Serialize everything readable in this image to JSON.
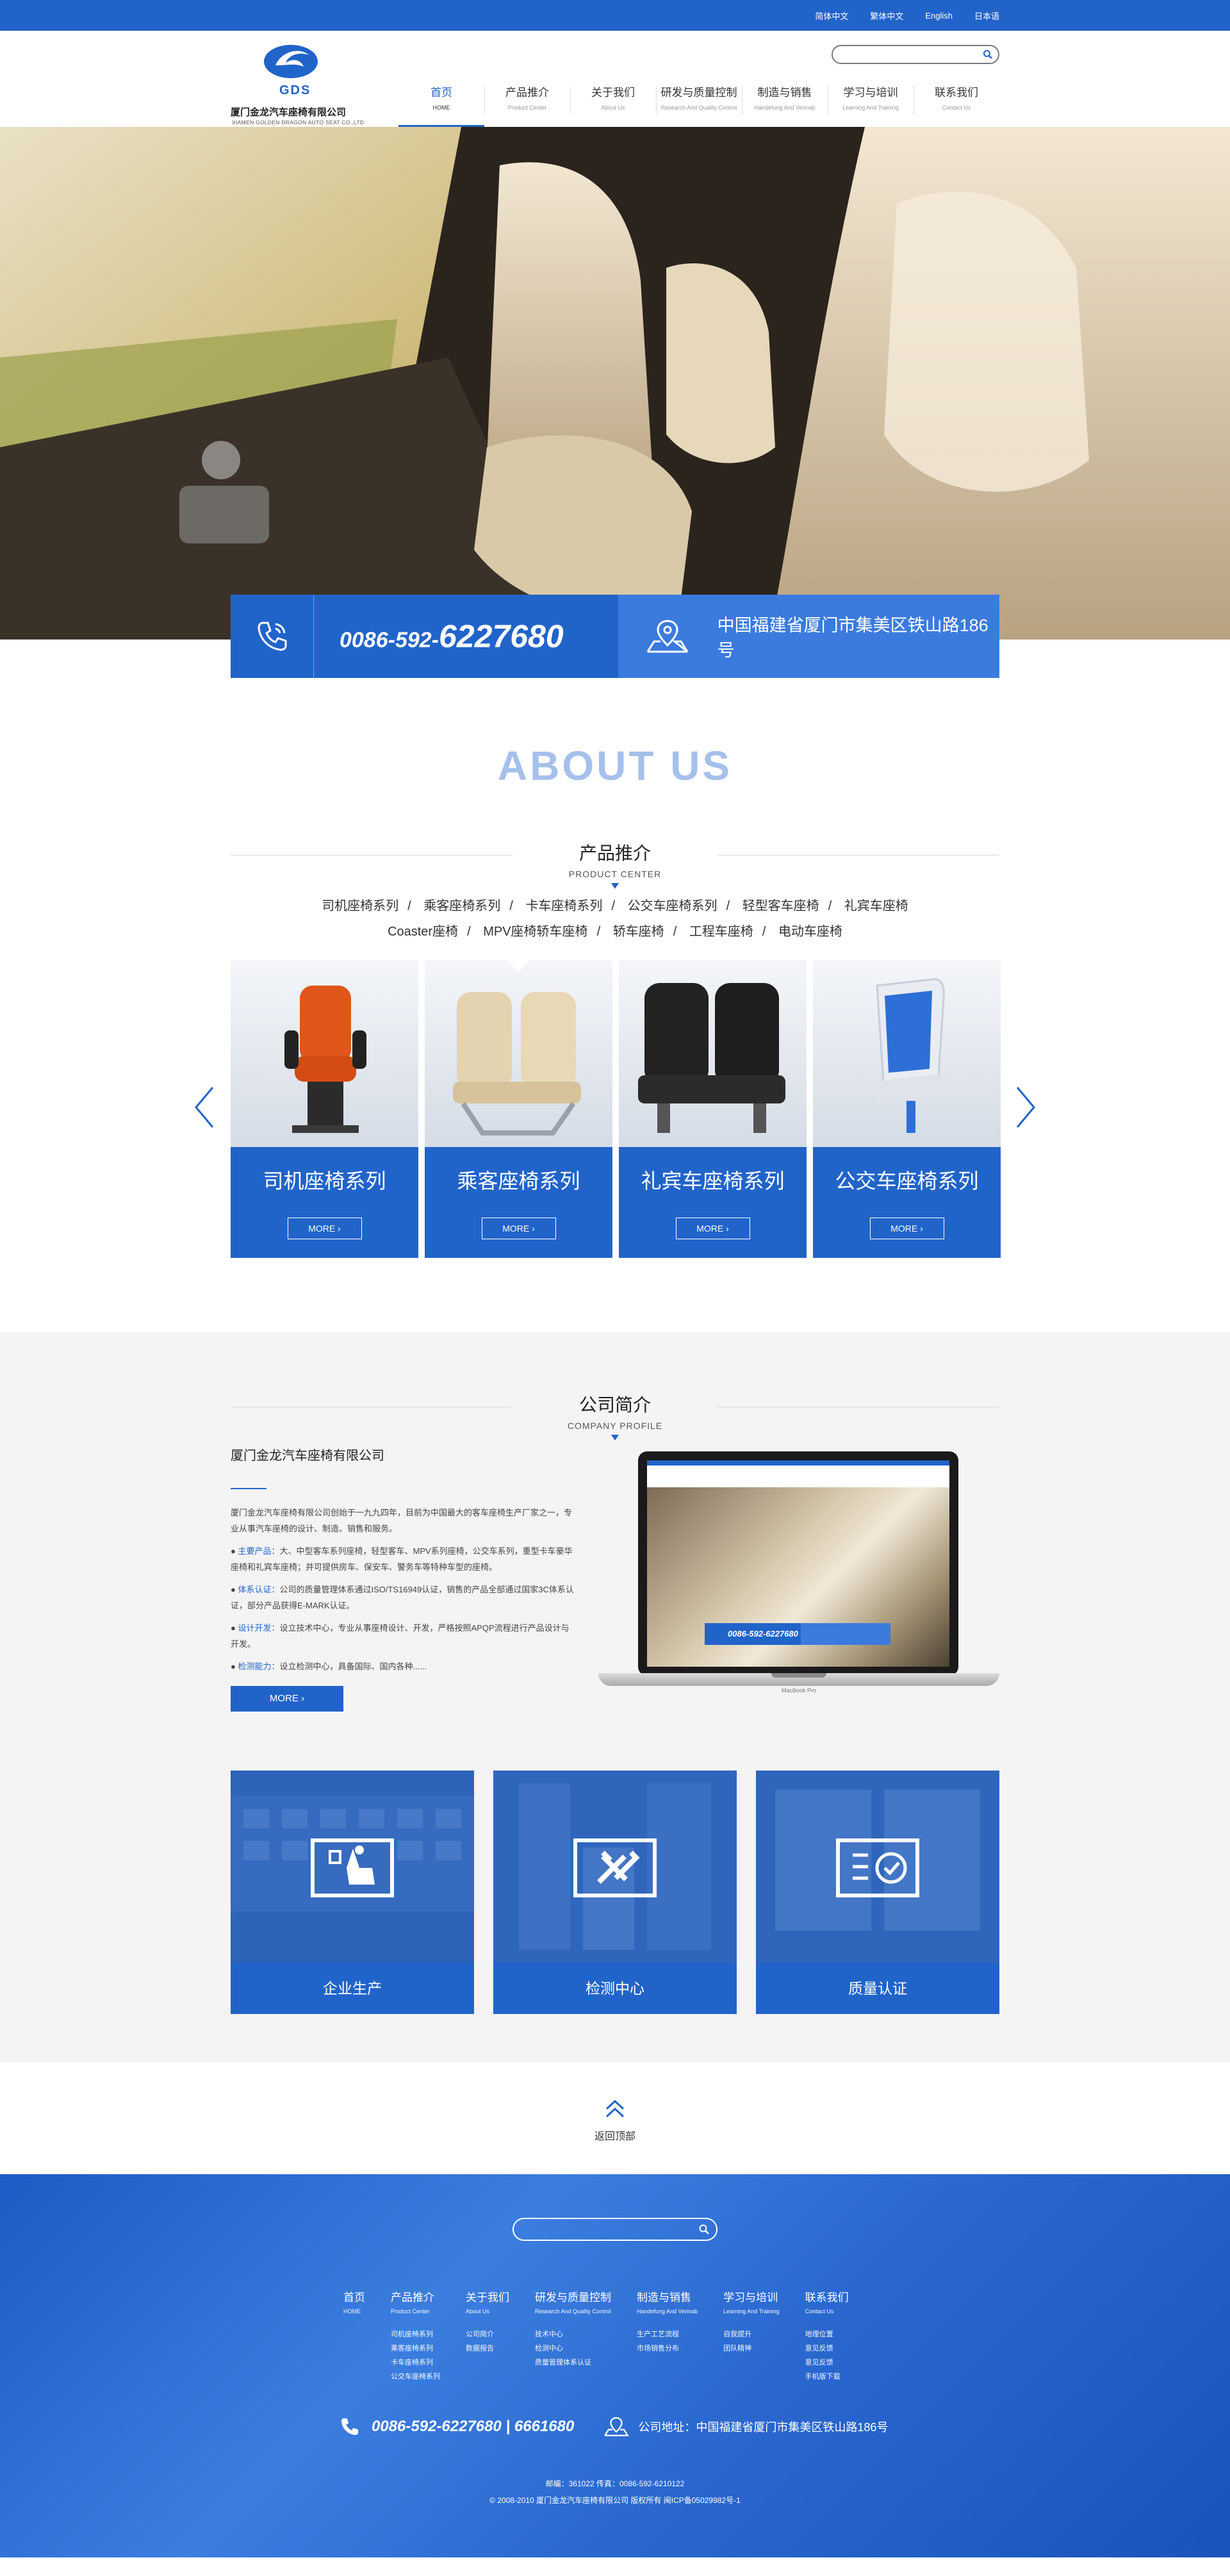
{
  "topbar": {
    "links": [
      "简体中文",
      "繁体中文",
      "English",
      "日本语"
    ]
  },
  "header": {
    "logo_abbr": "GDS",
    "company_cn": "厦门金龙汽车座椅有限公司",
    "company_en": "XIAMEN GOLDEN DRAGON AUTO SEAT CO.,LTD",
    "search_placeholder": ""
  },
  "nav": [
    {
      "cn": "首页",
      "en": "HOME",
      "active": true
    },
    {
      "cn": "产品推介",
      "en": "Product Center"
    },
    {
      "cn": "关于我们",
      "en": "About Us"
    },
    {
      "cn": "研发与质量控制",
      "en": "Research And Quality Control"
    },
    {
      "cn": "制造与销售",
      "en": "Handefung And Verinab"
    },
    {
      "cn": "学习与培训",
      "en": "Learning And Training"
    },
    {
      "cn": "联系我们",
      "en": "Contact Us"
    }
  ],
  "contact": {
    "phone_prefix": "0086-592-",
    "phone_main": "6227680",
    "address": "中国福建省厦门市集美区铁山路186号"
  },
  "about": {
    "big_title": "ABOUT US"
  },
  "product_section": {
    "title_cn": "产品推介",
    "title_en": "PRODUCT CENTER",
    "categories_row1": [
      "司机座椅系列",
      "乘客座椅系列",
      "卡车座椅系列",
      "公交车座椅系列",
      "轻型客车座椅",
      "礼宾车座椅"
    ],
    "categories_row2": [
      "Coaster座椅",
      "MPV座椅轿车座椅",
      "轿车座椅",
      "工程车座椅",
      "电动车座椅"
    ],
    "products": [
      {
        "name": "司机座椅系列",
        "more": "MORE ›"
      },
      {
        "name": "乘客座椅系列",
        "more": "MORE ›"
      },
      {
        "name": "礼宾车座椅系列",
        "more": "MORE ›"
      },
      {
        "name": "公交车座椅系列",
        "more": "MORE ›"
      }
    ]
  },
  "profile": {
    "title_cn": "公司简介",
    "title_en": "COMPANY PROFILE",
    "company": "厦门金龙汽车座椅有限公司",
    "intro": "厦门金龙汽车座椅有限公司创始于一九九四年，目前为中国最大的客车座椅生产厂家之一，专业从事汽车座椅的设计、制造、销售和服务。",
    "bullets": [
      {
        "k": "主要产品：",
        "v": "大、中型客车系列座椅，轻型客车、MPV系列座椅，公交车系列，重型卡车豪华座椅和礼宾车座椅；并可提供房车、保安车、警务车等特种车型的座椅。"
      },
      {
        "k": "体系认证：",
        "v": "公司的质量管理体系通过ISO/TS16949认证，销售的产品全部通过国家3C体系认证，部分产品获得E-MARK认证。"
      },
      {
        "k": "设计开发：",
        "v": "设立技术中心，专业从事座椅设计、开发，严格按照APQP流程进行产品设计与开发。"
      },
      {
        "k": "检测能力：",
        "v": "设立检测中心，具备国际、国内各种......"
      }
    ],
    "more": "MORE ›",
    "screen_phone": "0086-592-6227680",
    "laptop_brand": "MacBook Pro"
  },
  "tiles": [
    {
      "label": "企业生产"
    },
    {
      "label": "检测中心"
    },
    {
      "label": "质量认证"
    }
  ],
  "totop": {
    "label": "返回顶部"
  },
  "footer": {
    "columns": [
      {
        "h": "首页",
        "he": "HOME",
        "items": []
      },
      {
        "h": "产品推介",
        "he": "Product Center",
        "items": [
          "司机座椅系列",
          "乘客座椅系列",
          "卡车座椅系列",
          "公交车座椅系列"
        ]
      },
      {
        "h": "关于我们",
        "he": "About Us",
        "items": [
          "公司简介",
          "数据报告"
        ]
      },
      {
        "h": "研发与质量控制",
        "he": "Research And Quality Control",
        "items": [
          "技术中心",
          "检测中心",
          "质量管理体系认证"
        ]
      },
      {
        "h": "制造与销售",
        "he": "Handefung And Verinab",
        "items": [
          "生产工艺流程",
          "市场销售分布"
        ]
      },
      {
        "h": "学习与培训",
        "he": "Learning And Training",
        "items": [
          "自我提升",
          "团队精神"
        ]
      },
      {
        "h": "联系我们",
        "he": "Contact Us",
        "items": [
          "地理位置",
          "意见反馈",
          "意见反馈",
          "手机版下载"
        ]
      }
    ],
    "phone": "0086-592-6227680 | 6661680",
    "address": "公司地址：中国福建省厦门市集美区铁山路186号",
    "postal": "邮编：361022  传真：0086-592-6210122",
    "copyright": "© 2008-2010 厦门金龙汽车座椅有限公司 版权所有  闽ICP备05029982号-1"
  },
  "colors": {
    "primary": "#2164c9",
    "secondary": "#3b7bde"
  }
}
